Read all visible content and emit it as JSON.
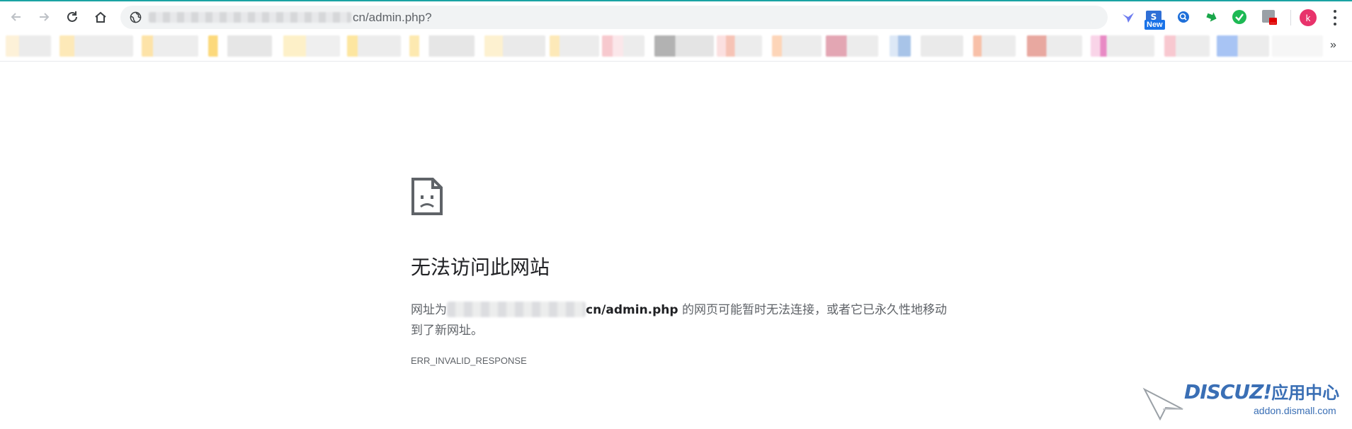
{
  "browser": {
    "url_suffix": "cn/admin.php?",
    "new_badge": "New",
    "profile_initial": "k",
    "bookmarks_overflow": "»"
  },
  "error_page": {
    "headline": "无法访问此网站",
    "desc_prefix": "网址为",
    "desc_url": "cn/admin.php",
    "desc_suffix": " 的网页可能暂时无法连接，或者它已永久性地移动到了新网址。",
    "error_code": "ERR_INVALID_RESPONSE"
  },
  "watermark": {
    "logo": "DISCUZ!",
    "logo_zh": "应用中心",
    "site": "addon.dismall.com"
  },
  "colors": {
    "accent": "#1a73e8",
    "profile": "#e8336b",
    "watermark": "#3a6fb5"
  }
}
